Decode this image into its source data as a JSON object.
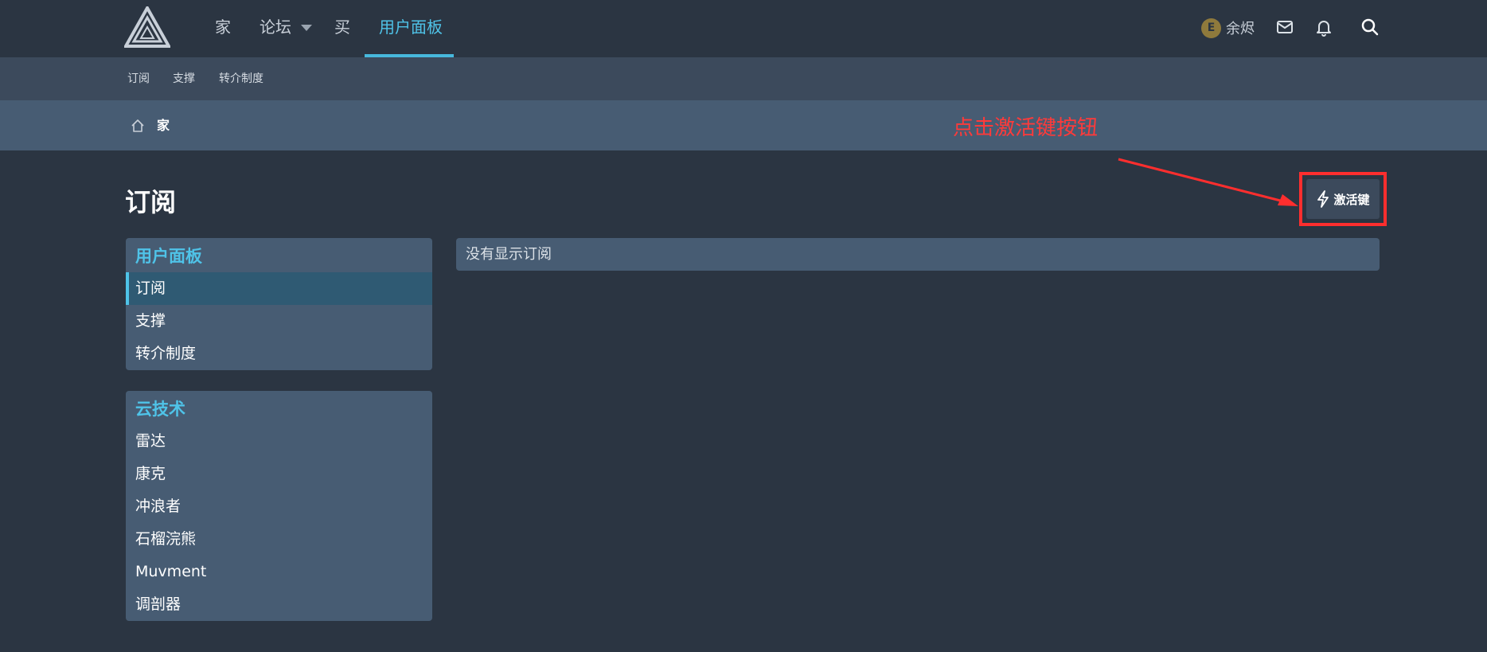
{
  "nav": {
    "items": [
      {
        "label": "家"
      },
      {
        "label": "论坛"
      },
      {
        "label": "买"
      },
      {
        "label": "用户面板"
      }
    ],
    "active": "用户面板"
  },
  "user": {
    "avatar_letter": "E",
    "name": "余烬"
  },
  "icons": {
    "logo": "triangle-logo-icon",
    "mail": "mail-icon",
    "bell": "bell-icon",
    "search": "search-icon",
    "home": "home-icon",
    "bolt": "bolt-icon"
  },
  "subnav": {
    "items": [
      {
        "label": "订阅"
      },
      {
        "label": "支撑"
      },
      {
        "label": "转介制度"
      }
    ]
  },
  "breadcrumb": {
    "items": [
      {
        "label": "家"
      }
    ]
  },
  "annotation": {
    "text": "点击激活键按钮",
    "color": "#ff3a3a"
  },
  "page": {
    "title": "订阅",
    "activate_button": "激活键",
    "notice": "没有显示订阅"
  },
  "sidebar": {
    "panels": [
      {
        "title": "用户面板",
        "items": [
          {
            "label": "订阅",
            "selected": true
          },
          {
            "label": "支撑"
          },
          {
            "label": "转介制度"
          }
        ]
      },
      {
        "title": "云技术",
        "items": [
          {
            "label": "雷达"
          },
          {
            "label": "康克"
          },
          {
            "label": "冲浪者"
          },
          {
            "label": "石榴浣熊"
          },
          {
            "label": "Muvment"
          },
          {
            "label": "调剖器"
          }
        ]
      }
    ]
  },
  "colors": {
    "background": "#2b3542",
    "accent": "#4fc3e8",
    "panel": "#475c73",
    "highlight": "#ff2e2e"
  }
}
